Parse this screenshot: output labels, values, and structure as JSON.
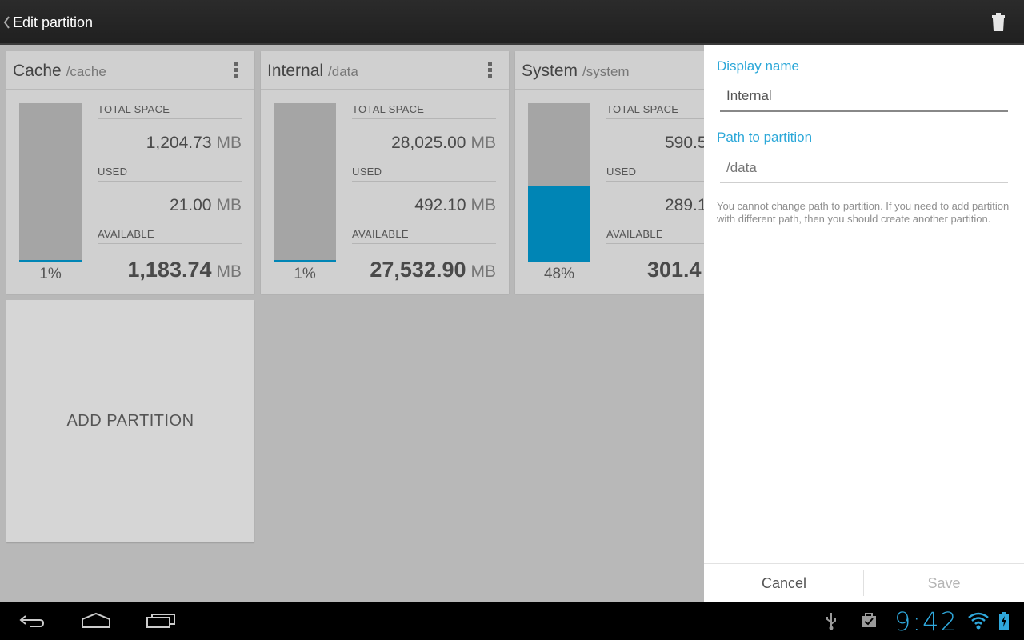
{
  "action_bar": {
    "title": "Edit partition",
    "back_icon": "chevron-left-icon",
    "delete_icon": "trash-icon"
  },
  "partitions": [
    {
      "name": "Cache",
      "path": "/cache",
      "total_label": "TOTAL SPACE",
      "total_value": "1,204.73",
      "used_label": "USED",
      "used_value": "21.00",
      "available_label": "AVAILABLE",
      "available_value": "1,183.74",
      "unit": "MB",
      "percent": "1%",
      "percent_fraction": 0.01
    },
    {
      "name": "Internal",
      "path": "/data",
      "total_label": "TOTAL SPACE",
      "total_value": "28,025.00",
      "used_label": "USED",
      "used_value": "492.10",
      "available_label": "AVAILABLE",
      "available_value": "27,532.90",
      "unit": "MB",
      "percent": "1%",
      "percent_fraction": 0.01
    },
    {
      "name": "System",
      "path": "/system",
      "total_label": "TOTAL SPACE",
      "total_value": "590.5",
      "used_label": "USED",
      "used_value": "289.1",
      "available_label": "AVAILABLE",
      "available_value": "301.4",
      "unit": "MB",
      "percent": "48%",
      "percent_fraction": 0.48
    }
  ],
  "add_card": {
    "label": "ADD PARTITION"
  },
  "edit_panel": {
    "display_name_label": "Display name",
    "display_name_value": "Internal",
    "path_label": "Path to partition",
    "path_value": "/data",
    "note": "You cannot change path to partition. If you need to add partition with different path, then you should create another partition.",
    "cancel_label": "Cancel",
    "save_label": "Save"
  },
  "status_bar": {
    "time": "9:42",
    "icons": [
      "usb-icon",
      "shopping-bag-icon",
      "wifi-icon",
      "battery-charging-icon"
    ]
  },
  "nav_bar": {
    "icons": [
      "back-icon",
      "home-icon",
      "recent-apps-icon"
    ]
  },
  "colors": {
    "accent": "#2aa7d8",
    "usage_fill": "#0085b5",
    "bar_bg": "#a5a5a5",
    "card_bg": "#d0d0d0",
    "content_bg": "#b8b8b8"
  }
}
